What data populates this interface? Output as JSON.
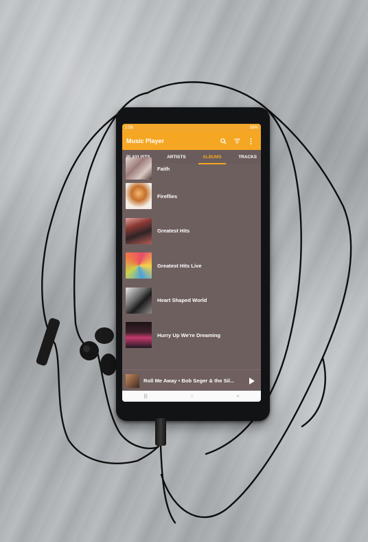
{
  "status_bar": {
    "time": "2:58",
    "status_icons": "58%"
  },
  "app": {
    "title": "Music Player",
    "search_icon": "search-icon",
    "sort_icon": "sort-icon",
    "menu_icon": "more-vert-icon"
  },
  "tabs": [
    {
      "label": "PLAYLISTS",
      "active": false
    },
    {
      "label": "ARTISTS",
      "active": false
    },
    {
      "label": "ALBUMS",
      "active": true
    },
    {
      "label": "TRACKS",
      "active": false
    }
  ],
  "albums": [
    {
      "title": "Faith"
    },
    {
      "title": "Fireflies"
    },
    {
      "title": "Greatest Hits"
    },
    {
      "title": "Greatest Hits Live"
    },
    {
      "title": "Heart Shaped World"
    },
    {
      "title": "Hurry Up We're Dreaming"
    }
  ],
  "now_playing": {
    "title": "Roll Me Away • Bob Seger & the Sil...",
    "play_icon": "play-icon"
  },
  "nav_bar": {
    "recents": "|||",
    "home": "○",
    "back": "<"
  },
  "colors": {
    "accent": "#f5a623",
    "list_background": "#6e5f5f",
    "text": "#ffffff"
  }
}
